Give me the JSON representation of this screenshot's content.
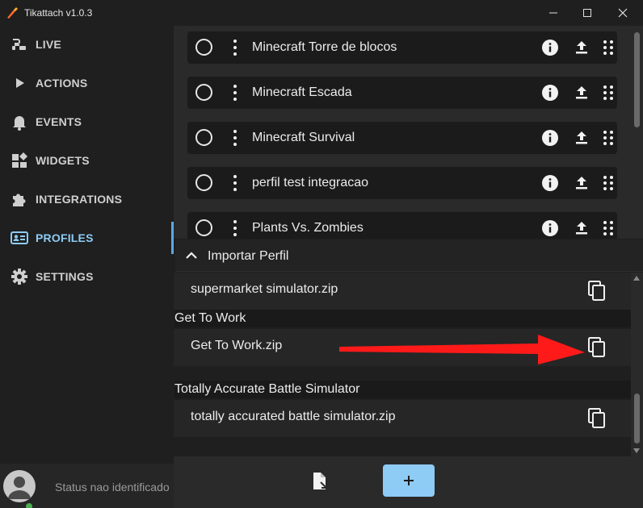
{
  "window": {
    "title": "Tikattach v1.0.3"
  },
  "sidebar": {
    "items": [
      {
        "label": "LIVE",
        "icon": "live-icon"
      },
      {
        "label": "ACTIONS",
        "icon": "play-icon"
      },
      {
        "label": "EVENTS",
        "icon": "bell-icon"
      },
      {
        "label": "WIDGETS",
        "icon": "widgets-icon"
      },
      {
        "label": "INTEGRATIONS",
        "icon": "puzzle-icon"
      },
      {
        "label": "PROFILES",
        "icon": "profile-card-icon",
        "active": true
      },
      {
        "label": "SETTINGS",
        "icon": "gear-icon"
      }
    ],
    "status_text": "Status nao identificado"
  },
  "profiles": [
    {
      "name": "Minecraft Torre de blocos"
    },
    {
      "name": "Minecraft Escada"
    },
    {
      "name": "Minecraft Survival"
    },
    {
      "name": "perfil test integracao"
    },
    {
      "name": "Plants Vs. Zombies"
    }
  ],
  "import_panel": {
    "title": "Importar Perfil",
    "groups": [
      {
        "label": "",
        "file": "supermarket simulator.zip"
      },
      {
        "label": "Get To Work",
        "file": "Get To Work.zip"
      },
      {
        "label": "Totally Accurate Battle Simulator",
        "file": "totally accurated battle simulator.zip"
      }
    ]
  },
  "colors": {
    "accent": "#8ecbf5",
    "active_indicator": "#5aa9e6",
    "annotation_arrow": "#ff1a1a",
    "status_online": "#4caf50"
  }
}
